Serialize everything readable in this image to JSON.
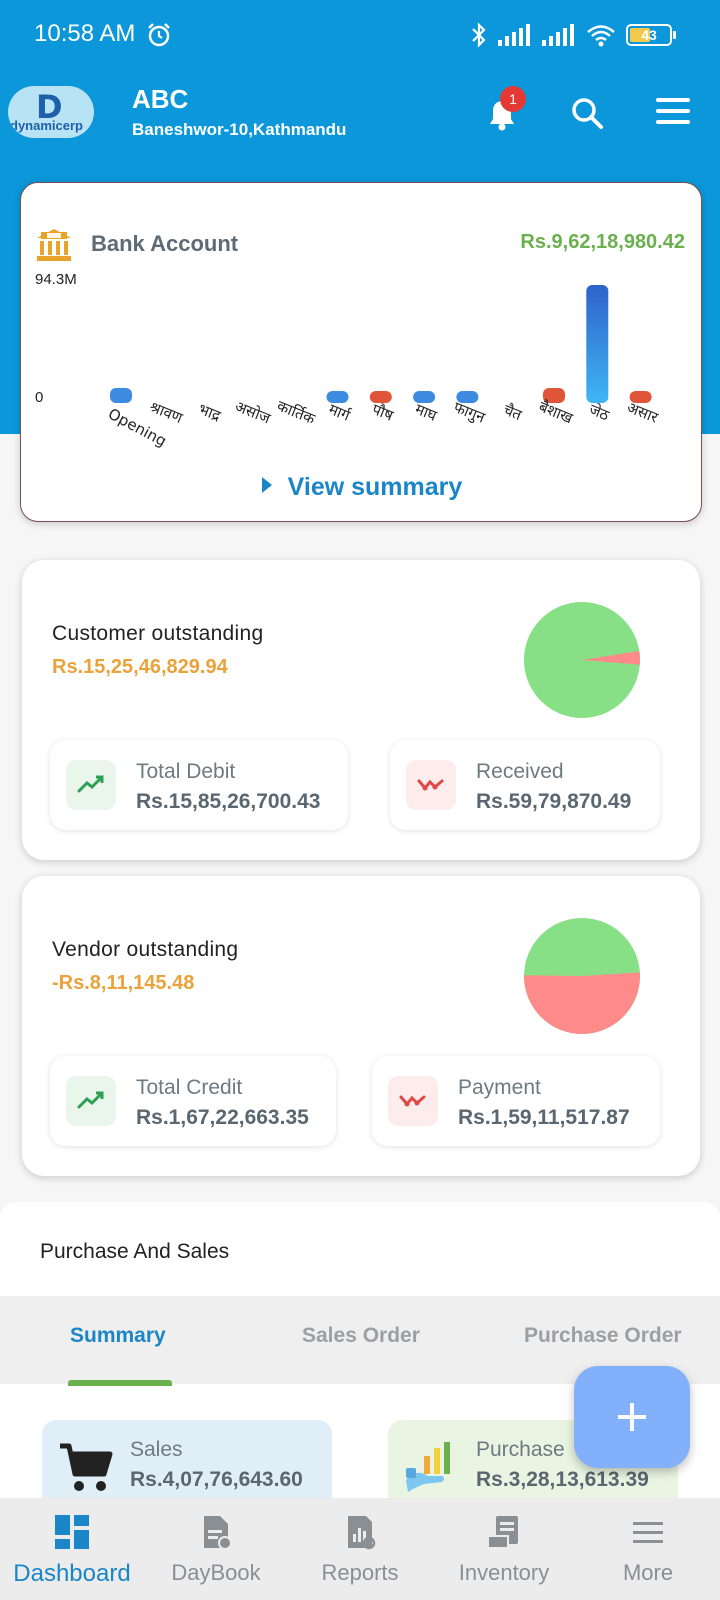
{
  "status_bar": {
    "time": "10:58 AM",
    "battery": "43"
  },
  "header": {
    "logo_text": "dynamicerp",
    "company": "ABC",
    "address": "Baneshwor-10,Kathmandu",
    "notification_count": "1"
  },
  "bank_account": {
    "title": "Bank Account",
    "amount": "Rs.9,62,18,980.42",
    "view_summary": "View summary",
    "chart_data": {
      "type": "bar",
      "ytick_labels": [
        "94.3M",
        "0"
      ],
      "ylim": [
        0,
        94.3
      ],
      "unit": "M",
      "categories": [
        "Opening",
        "श्रावण",
        "भाद्र",
        "असोज",
        "कार्तिक",
        "मार्ग",
        "पौष",
        "माघ",
        "फागुन",
        "चैत",
        "बैशाख",
        "जेठ",
        "असार"
      ],
      "values": [
        1.5,
        0,
        0,
        0,
        0,
        1,
        -1,
        1,
        1,
        0,
        -1.5,
        94.3,
        -1
      ],
      "colors": {
        "positive": "#3d8be0",
        "negative": "#e0553a",
        "peak": "#2a6fd6"
      }
    }
  },
  "customer_outstanding": {
    "title": "Customer  outstanding",
    "amount": "Rs.15,25,46,829.94",
    "pie": {
      "green_fraction": 0.962,
      "red_fraction": 0.038
    },
    "debit_label": "Total Debit",
    "debit_value": "Rs.15,85,26,700.43",
    "received_label": "Received",
    "received_value": "Rs.59,79,870.49"
  },
  "vendor_outstanding": {
    "title": "Vendor  outstanding",
    "amount": "-Rs.8,11,145.48",
    "pie": {
      "green_fraction": 0.488,
      "red_fraction": 0.512
    },
    "credit_label": "Total Credit",
    "credit_value": "Rs.1,67,22,663.35",
    "payment_label": "Payment",
    "payment_value": "Rs.1,59,11,517.87"
  },
  "purchase_sales": {
    "title": "Purchase And Sales",
    "tabs": [
      "Summary",
      "Sales Order",
      "Purchase Order"
    ],
    "sales_label": "Sales",
    "sales_value": "Rs.4,07,76,643.60",
    "purchase_label": "Purchase",
    "purchase_value": "Rs.3,28,13,613.39"
  },
  "bottom_nav": {
    "items": [
      "Dashboard",
      "DayBook",
      "Reports",
      "Inventory",
      "More"
    ],
    "active": "Dashboard"
  },
  "colors": {
    "primary": "#0b97d9",
    "accent_green": "#6ab04c",
    "amount_orange": "#eaa23a",
    "pie_green": "#88e086",
    "pie_red": "#ff8a8a",
    "fab": "#82b0fa"
  }
}
